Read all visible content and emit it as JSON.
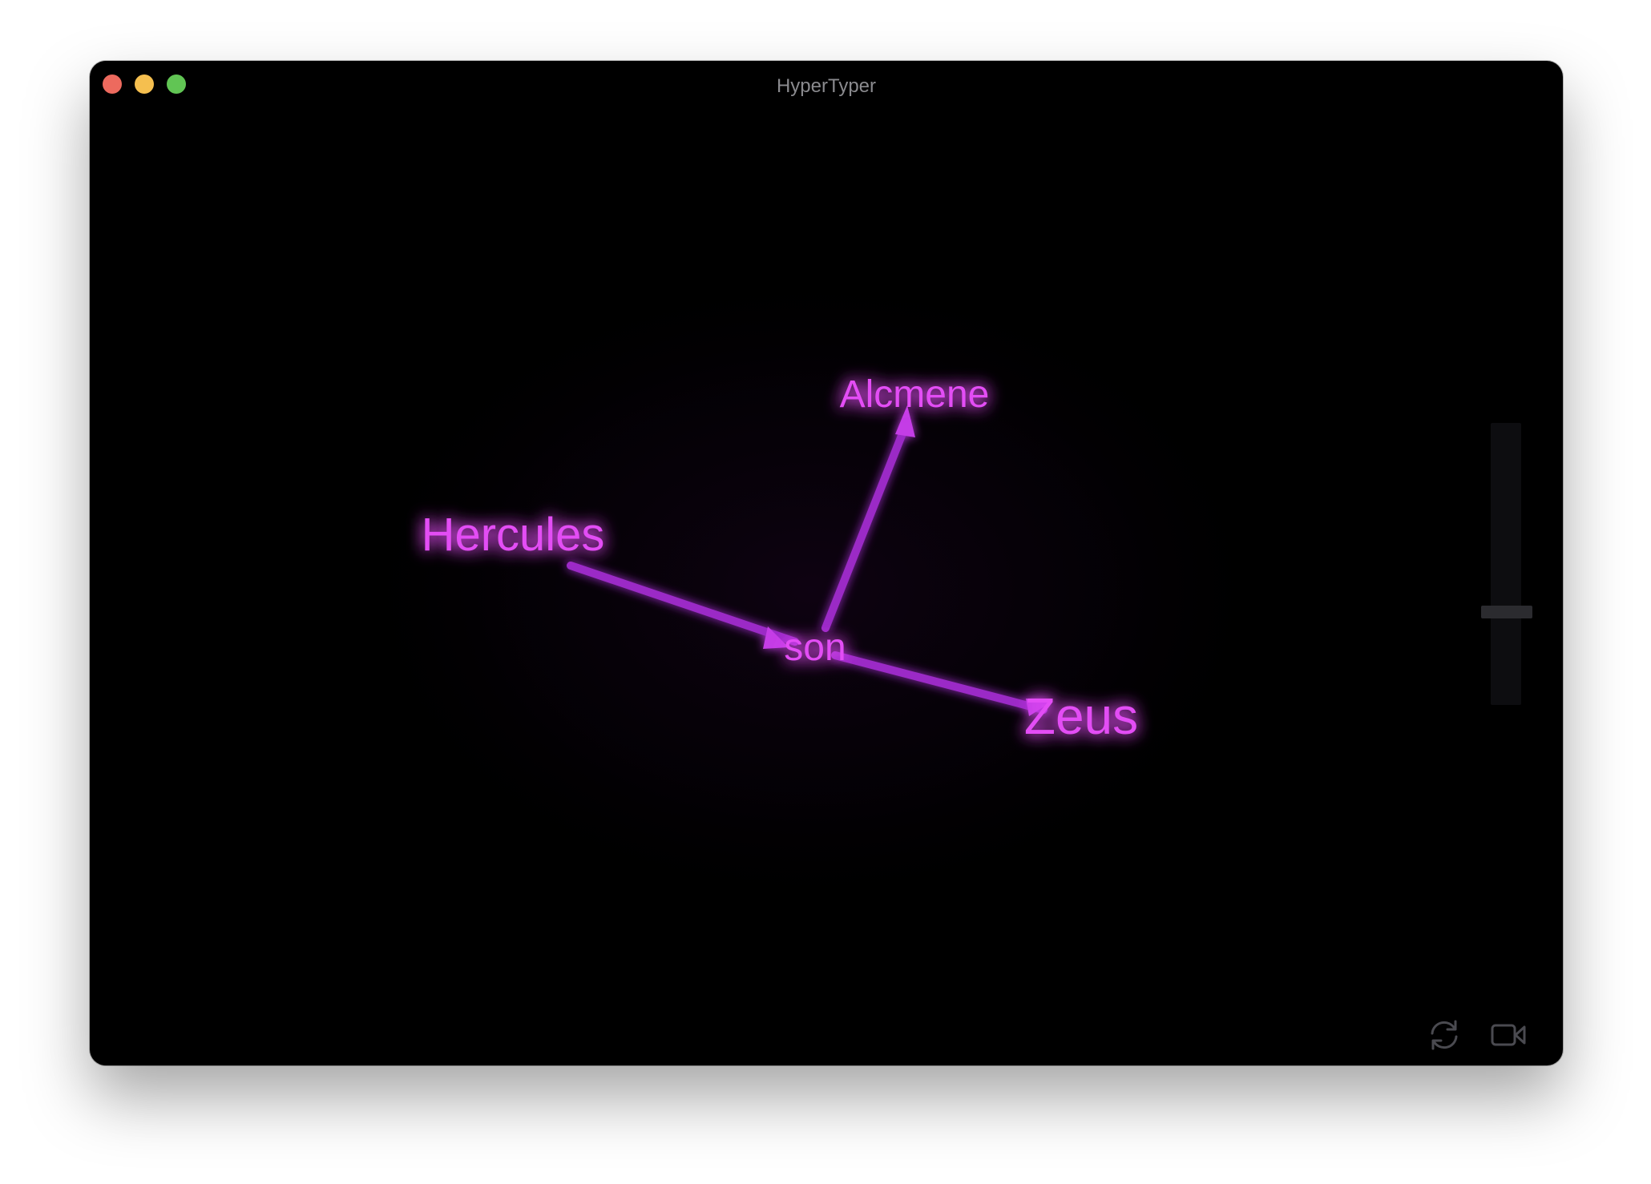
{
  "window": {
    "title": "HyperTyper"
  },
  "graph": {
    "accent_color": "#e040fb",
    "edge_color": "#9b2bc6",
    "nodes": [
      {
        "id": "alcmene",
        "label": "Alcmene"
      },
      {
        "id": "hercules",
        "label": "Hercules"
      },
      {
        "id": "son",
        "label": "son"
      },
      {
        "id": "zeus",
        "label": "Zeus"
      }
    ],
    "edges": [
      {
        "from": "son",
        "to": "alcmene"
      },
      {
        "from": "hercules",
        "to": "son"
      },
      {
        "from": "son",
        "to": "zeus"
      }
    ]
  },
  "controls": {
    "zoom_slider_value": 0.33,
    "reset_icon": "refresh-icon",
    "camera_icon": "video-camera-icon"
  }
}
